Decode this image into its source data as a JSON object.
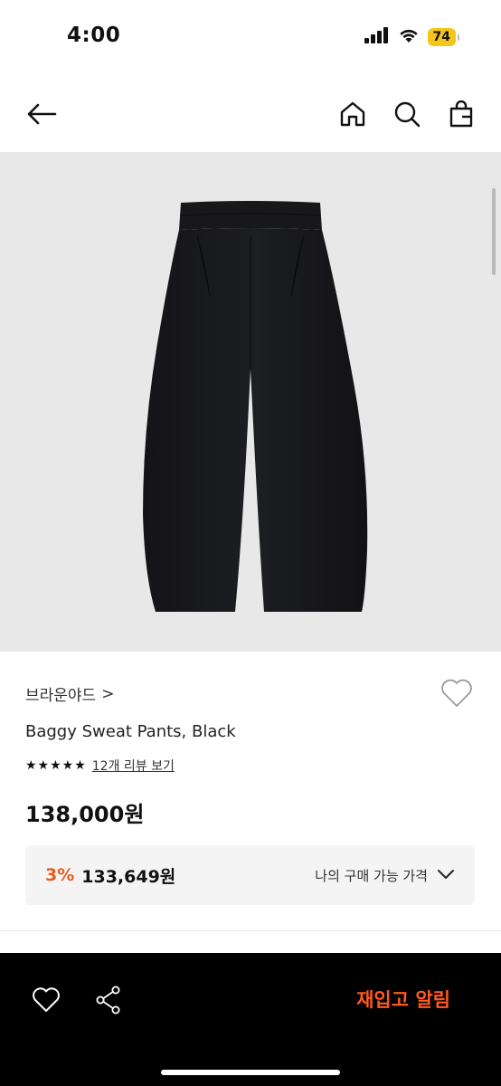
{
  "status": {
    "time": "4:00",
    "battery": "74"
  },
  "nav": {
    "icons": [
      "back-arrow-icon",
      "home-icon",
      "search-icon",
      "shopping-bag-icon"
    ]
  },
  "product": {
    "brand": "브라운야드",
    "brand_chevron": ">",
    "name": "Baggy Sweat Pants, Black",
    "stars": "★★★★★",
    "review_link": "12개 리뷰 보기",
    "price": "138,000원",
    "my_price": {
      "discount": "3%",
      "value": "133,649원",
      "label": "나의 구매 가능 가격"
    }
  },
  "bottom_bar": {
    "restock_label": "재입고 알림"
  },
  "colors": {
    "accent": "#ff5a1f",
    "discount": "#e85c1c",
    "hero_bg": "#e8e8e8",
    "bottom_bar_bg": "#000000"
  }
}
